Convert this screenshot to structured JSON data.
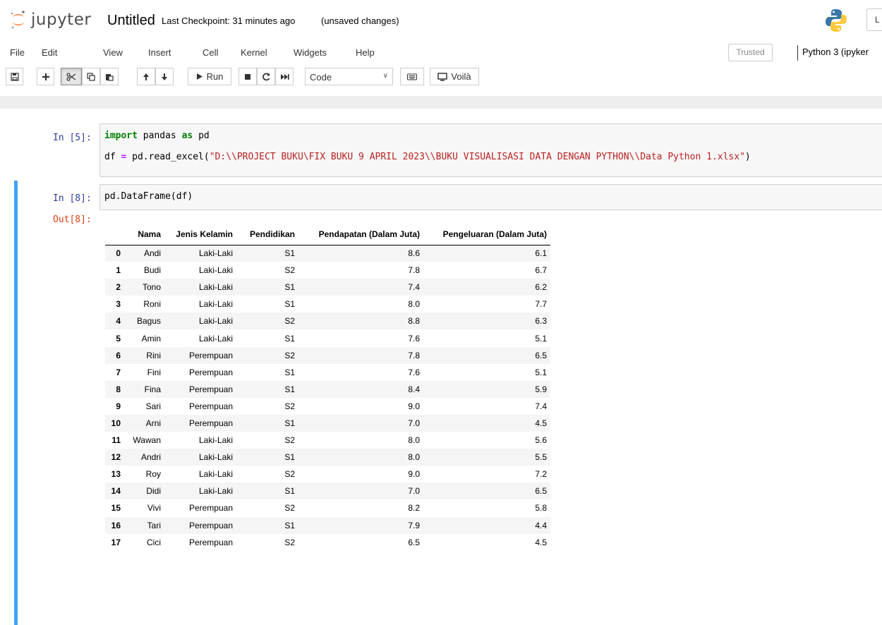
{
  "header": {
    "logo_text": "jupyter",
    "notebook_name": "Untitled",
    "checkpoint": "Last Checkpoint: 31 minutes ago",
    "autosave_status": "(unsaved changes)",
    "logout_label": "L"
  },
  "menubar": {
    "items": [
      "File",
      "Edit",
      "View",
      "Insert",
      "Cell",
      "Kernel",
      "Widgets",
      "Help"
    ],
    "trusted": "Trusted",
    "kernel": "Python 3 (ipyker"
  },
  "toolbar": {
    "run_label": "Run",
    "cell_type": "Code",
    "voila_label": "Voilà"
  },
  "cells": [
    {
      "prompt": "In [5]:",
      "line1_kw": "import",
      "line1_mid": " pandas ",
      "line1_kw2": "as",
      "line1_end": " pd",
      "line2_start": "df ",
      "line2_op": "=",
      "line2_mid": " pd.read_excel(",
      "line2_str": "\"D:\\\\PROJECT BUKU\\FIX BUKU 9 APRIL 2023\\\\BUKU VISUALISASI DATA DENGAN PYTHON\\\\Data Python 1.xlsx\"",
      "line2_end": ")"
    },
    {
      "prompt": "In [8]:",
      "code": "pd.DataFrame(df)",
      "out_prompt": "Out[8]:"
    }
  ],
  "dataframe": {
    "columns": [
      "",
      "Nama",
      "Jenis Kelamin",
      "Pendidikan",
      "Pendapatan (Dalam Juta)",
      "Pengeluaran (Dalam Juta)"
    ],
    "rows": [
      [
        "0",
        "Andi",
        "Laki-Laki",
        "S1",
        "8.6",
        "6.1"
      ],
      [
        "1",
        "Budi",
        "Laki-Laki",
        "S2",
        "7.8",
        "6.7"
      ],
      [
        "2",
        "Tono",
        "Laki-Laki",
        "S1",
        "7.4",
        "6.2"
      ],
      [
        "3",
        "Roni",
        "Laki-Laki",
        "S1",
        "8.0",
        "7.7"
      ],
      [
        "4",
        "Bagus",
        "Laki-Laki",
        "S2",
        "8.8",
        "6.3"
      ],
      [
        "5",
        "Amin",
        "Laki-Laki",
        "S1",
        "7.6",
        "5.1"
      ],
      [
        "6",
        "Rini",
        "Perempuan",
        "S2",
        "7.8",
        "6.5"
      ],
      [
        "7",
        "Fini",
        "Perempuan",
        "S1",
        "7.6",
        "5.1"
      ],
      [
        "8",
        "Fina",
        "Perempuan",
        "S1",
        "8.4",
        "5.9"
      ],
      [
        "9",
        "Sari",
        "Perempuan",
        "S2",
        "9.0",
        "7.4"
      ],
      [
        "10",
        "Arni",
        "Perempuan",
        "S1",
        "7.0",
        "4.5"
      ],
      [
        "11",
        "Wawan",
        "Laki-Laki",
        "S2",
        "8.0",
        "5.6"
      ],
      [
        "12",
        "Andri",
        "Laki-Laki",
        "S1",
        "8.0",
        "5.5"
      ],
      [
        "13",
        "Roy",
        "Laki-Laki",
        "S2",
        "9.0",
        "7.2"
      ],
      [
        "14",
        "Didi",
        "Laki-Laki",
        "S1",
        "7.0",
        "6.5"
      ],
      [
        "15",
        "Vivi",
        "Perempuan",
        "S2",
        "8.2",
        "5.8"
      ],
      [
        "16",
        "Tari",
        "Perempuan",
        "S1",
        "7.9",
        "4.4"
      ],
      [
        "17",
        "Cici",
        "Perempuan",
        "S2",
        "6.5",
        "4.5"
      ]
    ]
  },
  "colors": {
    "in_prompt": "#303f9f",
    "out_prompt": "#d84315",
    "selected_bar": "#42a5f5",
    "keyword": "#008000",
    "string": "#ba2121",
    "logo_orange": "#f37726"
  }
}
